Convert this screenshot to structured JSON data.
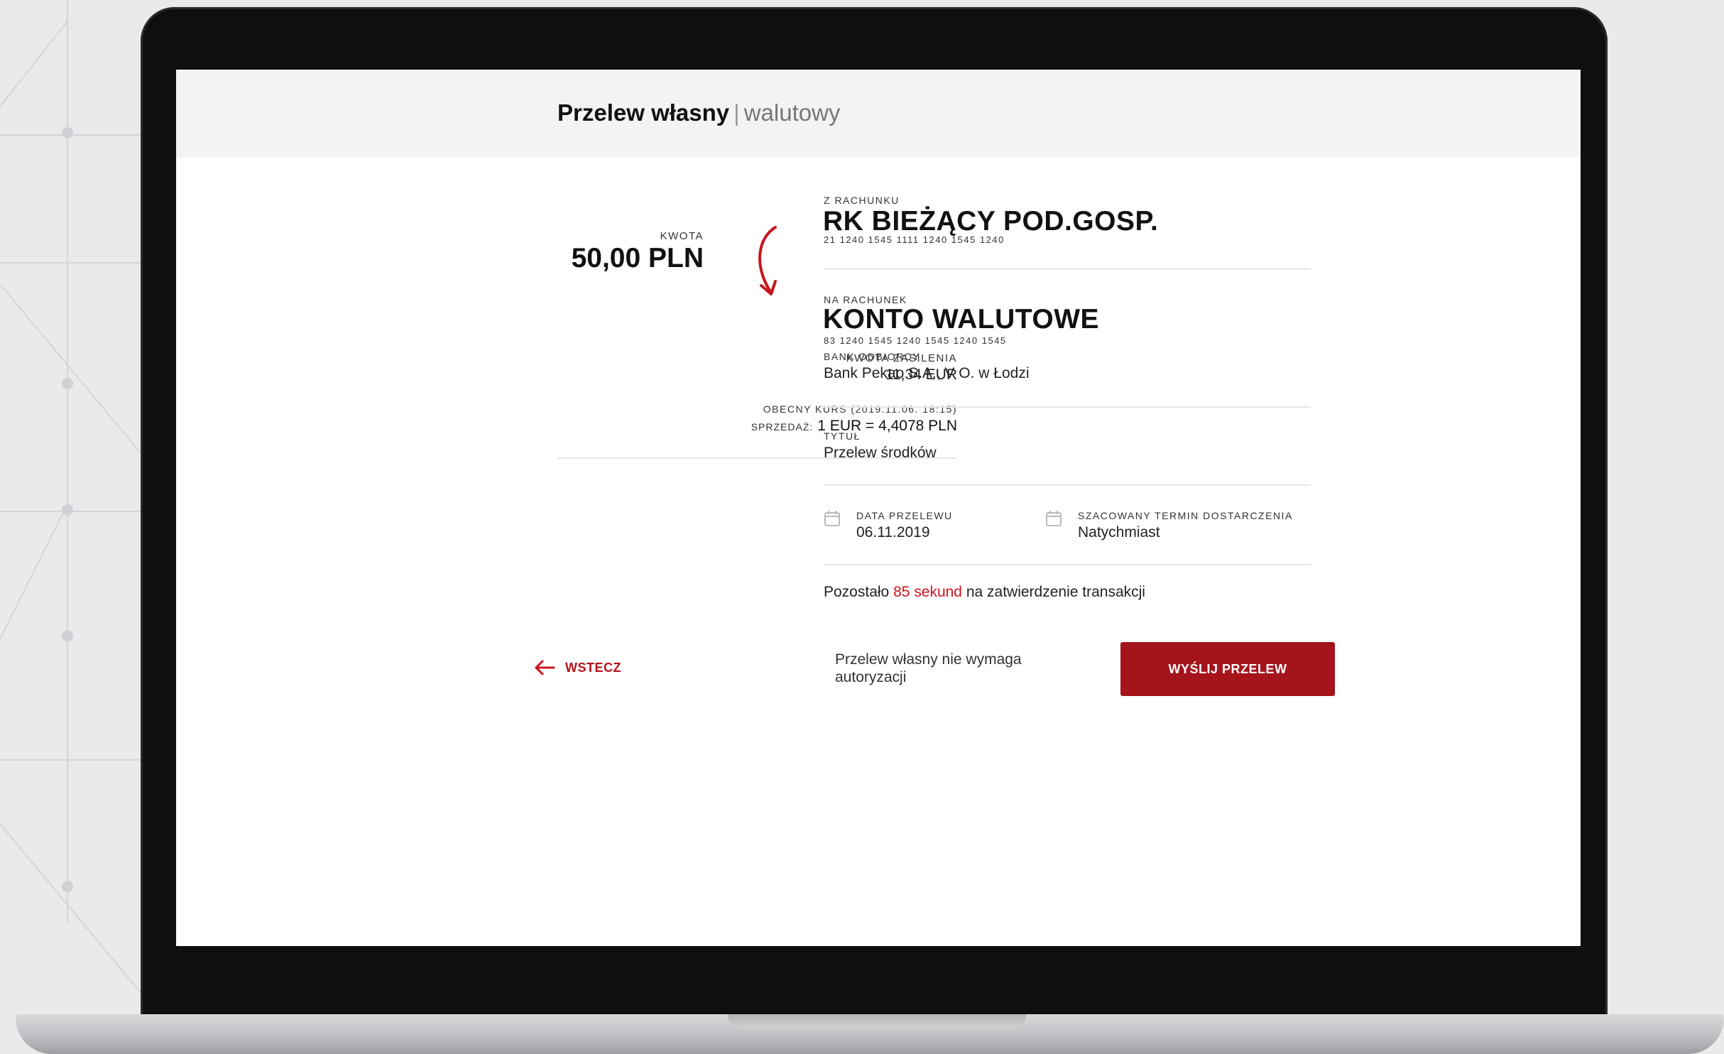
{
  "header": {
    "title_main": "Przelew własny",
    "title_separator": "|",
    "title_sub": "walutowy"
  },
  "amount": {
    "label": "KWOTA",
    "value": "50,00 PLN"
  },
  "funding": {
    "label": "KWOTA ZASILENIA",
    "value": "11,34 EUR"
  },
  "rate": {
    "label": "OBECNY KURS (2019.11.06. 18:15)",
    "prefix": "SPRZEDAŻ:",
    "value": "1 EUR = 4,4078 PLN"
  },
  "from_account": {
    "label": "Z RACHUNKU",
    "name": "RK BIEŻĄCY POD.GOSP.",
    "number": "21 1240 1545 1111 1240 1545 1240"
  },
  "to_account": {
    "label": "NA RACHUNEK",
    "name": "KONTO WALUTOWE",
    "number": "83 1240 1545 1240 1545 1240 1545",
    "bank_label": "BANK ODBIORCY",
    "bank_value": "Bank Pekao S.A., V O. w Łodzi"
  },
  "title_field": {
    "label": "TYTUŁ",
    "value": "Przelew środków"
  },
  "transfer_date": {
    "label": "DATA PRZELEWU",
    "value": "06.11.2019"
  },
  "delivery": {
    "label": "SZACOWANY TERMIN DOSTARCZENIA",
    "value": "Natychmiast"
  },
  "countdown": {
    "before": "Pozostało",
    "highlight": "85 sekund",
    "after": "na zatwierdzenie transakcji"
  },
  "back": {
    "label": "WSTECZ"
  },
  "auth_note": "Przelew własny nie wymaga autoryzacji",
  "send_button": {
    "label": "WYŚLIJ PRZELEW"
  },
  "colors": {
    "accent": "#a5131b",
    "accent_text": "#d0131c",
    "screen_bg": "#ffffff",
    "header_bg": "#f3f3f3"
  },
  "icons": [
    "curved-arrow-down-icon",
    "calendar-icon",
    "arrow-left-icon"
  ]
}
